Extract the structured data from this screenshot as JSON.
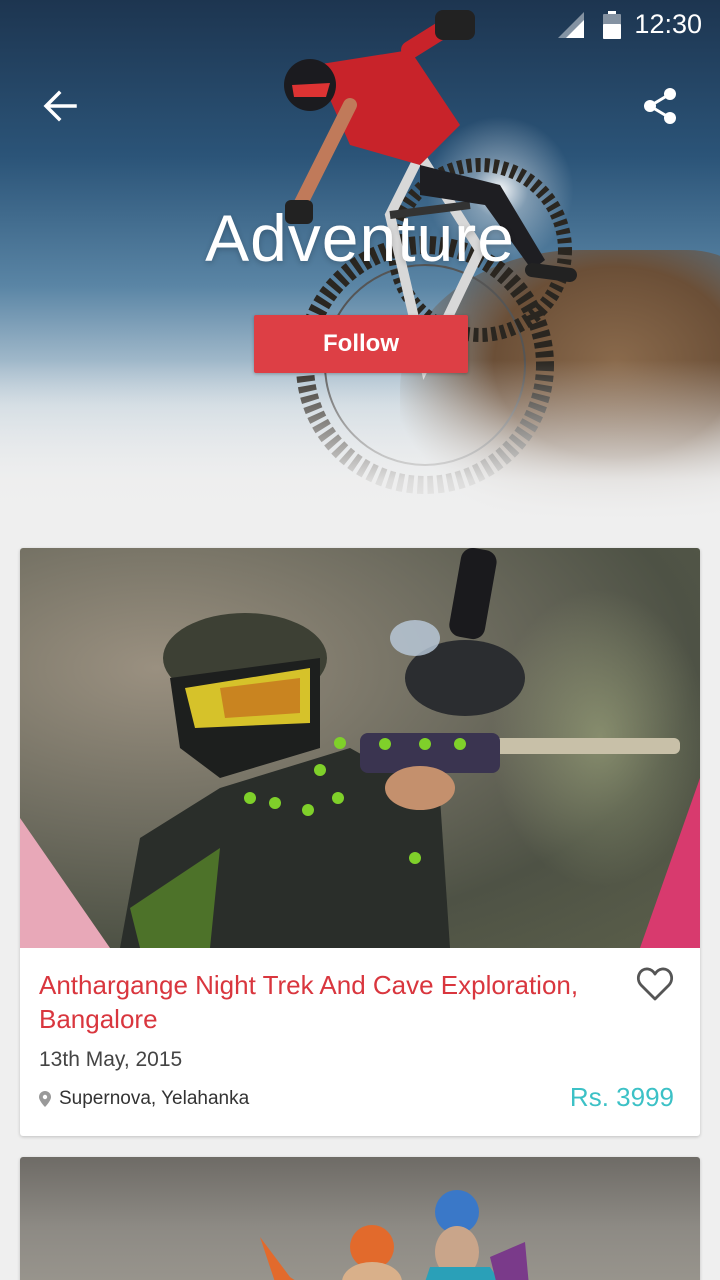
{
  "status_bar": {
    "time": "12:30",
    "signal_icon": "signal-icon",
    "battery_icon": "battery-icon"
  },
  "header": {
    "title": "Adventure",
    "follow_label": "Follow",
    "back_icon": "arrow-back-icon",
    "share_icon": "share-icon"
  },
  "events": [
    {
      "title": "Anthargange Night Trek And Cave Exploration, Bangalore",
      "date": "13th May, 2015",
      "location": "Supernova, Yelahanka",
      "price": "Rs. 3999",
      "favorite_icon": "heart-outline-icon"
    }
  ],
  "colors": {
    "accent_red": "#dd3f45",
    "title_red": "#d9363e",
    "price_teal": "#3cc1c6"
  }
}
